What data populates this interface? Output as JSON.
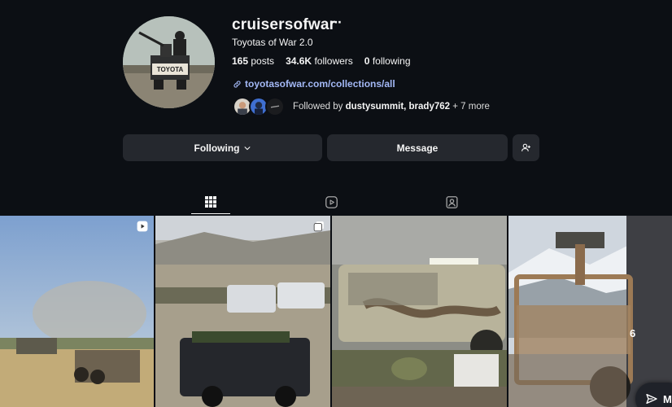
{
  "profile": {
    "username": "cruisersofwar",
    "more_icon": "more-dots-icon",
    "full_name": "Toyotas of War 2.0",
    "posts_count": "165",
    "posts_label": "posts",
    "followers_count": "34.6K",
    "followers_label": "followers",
    "following_count": "0",
    "following_label": "following",
    "link_text": "toyotasofwar.com/collections/all",
    "followed_by_prefix": "Followed by",
    "followed_by_users": "dustysummit, brady762",
    "followed_by_more": "+ 7 more",
    "avatar_text": "TOYOTA"
  },
  "actions": {
    "following_label": "Following",
    "message_label": "Message"
  },
  "tabs": [
    {
      "name": "posts",
      "icon": "grid-icon",
      "active": true
    },
    {
      "name": "reels",
      "icon": "reels-icon",
      "active": false
    },
    {
      "name": "tagged",
      "icon": "tagged-icon",
      "active": false
    }
  ],
  "grid": {
    "tiles": [
      {
        "type": "reel",
        "badge_icon": "reel-icon"
      },
      {
        "type": "carousel",
        "badge_icon": "carousel-icon"
      },
      {
        "type": "photo"
      },
      {
        "type": "photo"
      }
    ],
    "overlay_count": "6"
  },
  "messages_fab": {
    "label": "M",
    "icon": "send-icon"
  },
  "colors": {
    "background": "#0c0f14",
    "button": "#25282e",
    "link": "#a3b8f5"
  }
}
